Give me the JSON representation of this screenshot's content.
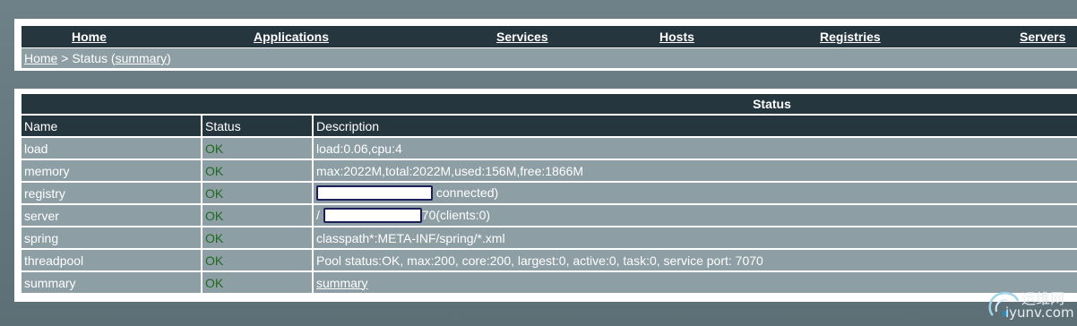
{
  "nav": {
    "home": "Home",
    "applications": "Applications",
    "services": "Services",
    "hosts": "Hosts",
    "registries": "Registries",
    "servers": "Servers"
  },
  "breadcrumb": {
    "home": "Home",
    "separator": " > Status (",
    "summary": "summary",
    "close": ")"
  },
  "status_table": {
    "title": "Status",
    "headers": {
      "name": "Name",
      "status": "Status",
      "description": "Description"
    },
    "rows": [
      {
        "name": "load",
        "status": "OK",
        "description": "load:0.06,cpu:4"
      },
      {
        "name": "memory",
        "status": "OK",
        "description": "max:2022M,total:2022M,used:156M,free:1866M"
      },
      {
        "name": "registry",
        "status": "OK",
        "description_suffix": " connected)"
      },
      {
        "name": "server",
        "status": "OK",
        "description_prefix": "/",
        "description_suffix": "70(clients:0)"
      },
      {
        "name": "spring",
        "status": "OK",
        "description": "classpath*:META-INF/spring/*.xml"
      },
      {
        "name": "threadpool",
        "status": "OK",
        "description": "Pool status:OK, max:200, core:200, largest:0, active:0, task:0, service port: 7070"
      },
      {
        "name": "summary",
        "status": "OK",
        "description_link": "summary"
      }
    ]
  },
  "watermark": {
    "name": "运维网",
    "url": "iyunv.com"
  },
  "colors": {
    "header_bg": "#26363f",
    "row_bg": "#8d9ea5",
    "ok_text": "#1f6b1f",
    "page_bg": "#6e8188"
  }
}
